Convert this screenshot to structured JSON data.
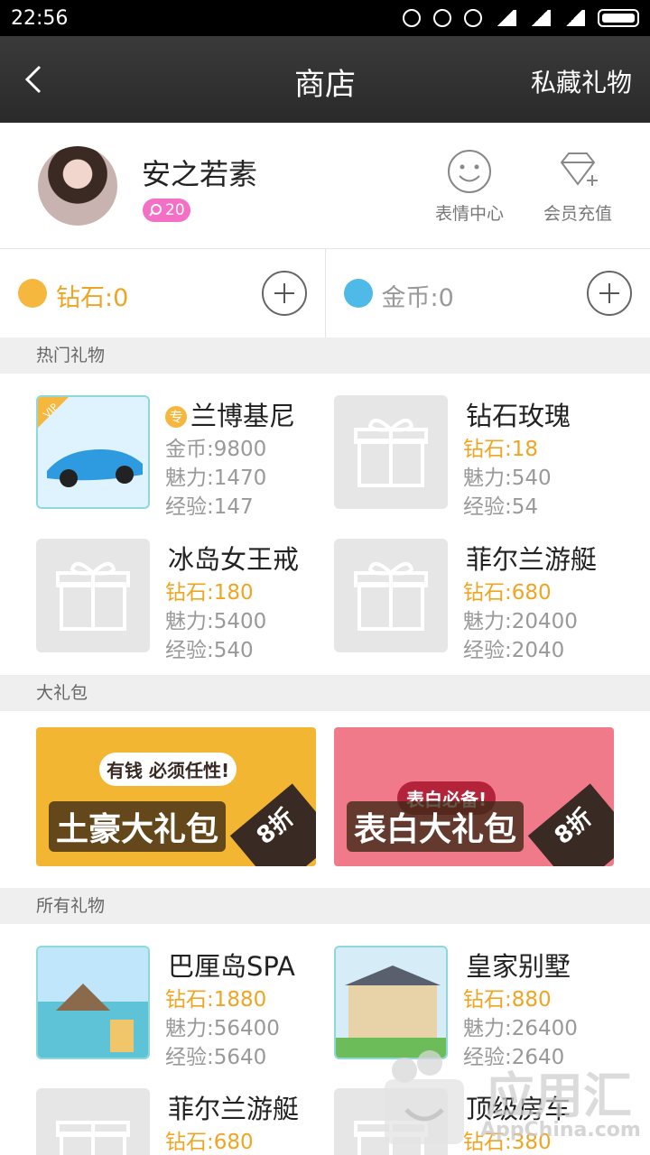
{
  "status_bar": {
    "time": "22:56"
  },
  "nav": {
    "title": "商店",
    "right_action": "私藏礼物"
  },
  "profile": {
    "name": "安之若素",
    "level": "20",
    "actions": [
      {
        "label": "表情中心"
      },
      {
        "label": "会员充值"
      }
    ]
  },
  "balance": {
    "diamond": "钻石:0",
    "coin": "金币:0"
  },
  "sections": {
    "hot": "热门礼物",
    "packs": "大礼包",
    "all": "所有礼物"
  },
  "hot_gifts": [
    {
      "name": "兰博基尼",
      "exclusive_tag": "专",
      "badge": "VIP",
      "price": "金币:9800",
      "charm": "魅力:1470",
      "exp": "经验:147"
    },
    {
      "name": "钻石玫瑰",
      "price": "钻石:18",
      "charm": "魅力:540",
      "exp": "经验:54"
    },
    {
      "name": "冰岛女王戒",
      "price": "钻石:180",
      "charm": "魅力:5400",
      "exp": "经验:540"
    },
    {
      "name": "菲尔兰游艇",
      "price": "钻石:680",
      "charm": "魅力:20400",
      "exp": "经验:2040"
    }
  ],
  "packs": [
    {
      "title": "土豪大礼包",
      "subtitle": "有钱 必须任性!",
      "discount": "8折"
    },
    {
      "title": "表白大礼包",
      "subtitle": "表白必备!",
      "discount": "8折"
    }
  ],
  "all_gifts": [
    {
      "name": "巴厘岛SPA",
      "price": "钻石:1880",
      "charm": "魅力:56400",
      "exp": "经验:5640"
    },
    {
      "name": "皇家别墅",
      "price": "钻石:880",
      "charm": "魅力:26400",
      "exp": "经验:2640"
    },
    {
      "name": "菲尔兰游艇",
      "price": "钻石:680"
    },
    {
      "name": "顶级房车",
      "price": "钻石:380"
    }
  ],
  "watermark": {
    "brand": "应用汇",
    "url": "AppChina.com"
  },
  "colors": {
    "gold": "#f0a522",
    "level_pink": "#f46fc6",
    "navbar": "#333333"
  }
}
